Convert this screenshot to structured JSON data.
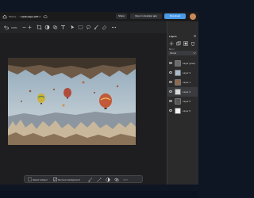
{
  "app": {
    "breadcrumb_prev": "Photos",
    "breadcrumb_sep": ">",
    "file_title": "Landscape edit",
    "title_buttons": {
      "share": "Share",
      "open_desktop": "Open in desktop app",
      "download": "Download",
      "account": "Account"
    }
  },
  "toolbar": {
    "zoom": "100%"
  },
  "panel": {
    "title": "Layers",
    "blend_label": "Blend",
    "blend_value": "Normal",
    "layers": [
      {
        "name": "Layer group",
        "thumb_color": "#6b6b6b",
        "selected": false
      },
      {
        "name": "Layer 3",
        "thumb_color": "#a9b8c6",
        "selected": false
      },
      {
        "name": "Layer 1",
        "thumb_color": "#8b6a4d",
        "selected": false
      },
      {
        "name": "Layer 2",
        "thumb_color": "#d7d7d7",
        "selected": true
      },
      {
        "name": "Layer 5",
        "thumb_color": "#555555",
        "selected": false
      },
      {
        "name": "Layer 6",
        "thumb_color": "#f2f2f2",
        "selected": false
      }
    ]
  },
  "context_bar": {
    "select_subject": "Select subject",
    "remove_background": "Remove background"
  },
  "colors": {
    "accent": "#4a9be8",
    "window_bg": "#202124",
    "panel_bg": "#2b2b2c"
  }
}
